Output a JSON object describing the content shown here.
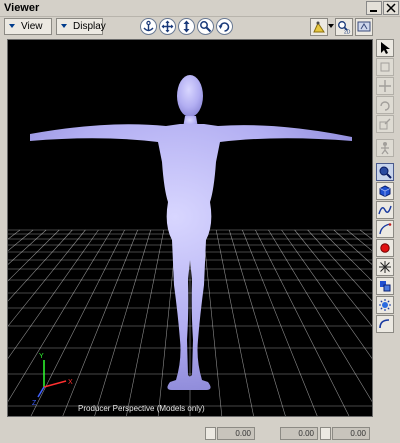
{
  "window": {
    "title": "Viewer"
  },
  "toolbar": {
    "view_label": "View",
    "display_label": "Display"
  },
  "viewport": {
    "camera_label": "Producer Perspective (Models only)"
  },
  "status": {
    "field1": "0.00",
    "field2": "0.00",
    "field3": "0.00"
  },
  "colors": {
    "model": "#b8b4f4",
    "grid": "#ffffff",
    "background": "#000000",
    "axis_x": "#ff3030",
    "axis_y": "#30ff30",
    "axis_z": "#4060ff"
  }
}
